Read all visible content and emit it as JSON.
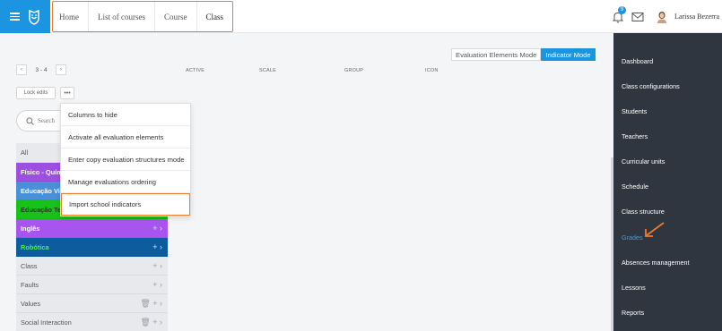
{
  "header": {
    "breadcrumbs": [
      "Home",
      "List of courses",
      "Course",
      "Class"
    ],
    "notifications_count": "9",
    "user_name": "Larissa Bezerra"
  },
  "modes": {
    "evaluation": "Evaluation Elements Mode",
    "indicator": "Indicator Mode"
  },
  "pager": {
    "prev": "‹",
    "range": "3 - 4",
    "next": "›"
  },
  "columns": [
    "ACTIVE",
    "SCALE",
    "GROUP",
    "ICON"
  ],
  "toolbar": {
    "lock_label": "Lock edits",
    "more_label": "•••"
  },
  "search": {
    "placeholder": "Search"
  },
  "list": {
    "all_label": "All",
    "items": [
      {
        "label": "Físico - Química",
        "bg": "#9c4fe0",
        "fg": "#ffffff"
      },
      {
        "label": "Educação Visual",
        "bg": "#4a90d9",
        "fg": "#ffffff"
      },
      {
        "label": "Educação Tecnológica",
        "bg": "#19c219",
        "fg": "#1a3a1a"
      },
      {
        "label": "Inglês",
        "bg": "#a855f0",
        "fg": "#ffffff",
        "actions": "+ ›"
      },
      {
        "label": "Robótica",
        "bg": "#0d5c9e",
        "fg": "#4cf04c",
        "actions": "+ ›"
      },
      {
        "label": "Class",
        "actions": "+ ›"
      },
      {
        "label": "Faults",
        "actions": "+ ›"
      },
      {
        "label": "Values",
        "actions": "🗑 + ›"
      },
      {
        "label": "Social Interaction",
        "actions": "🗑 + ›"
      }
    ]
  },
  "menu": {
    "items": [
      "Columns to hide",
      "Activate all evaluation elements",
      "Enter copy evaluation structures mode",
      "Manage evaluations ordering",
      "Import school indicators"
    ]
  },
  "sidebar": {
    "items": [
      "Dashboard",
      "Class configurations",
      "Students",
      "Teachers",
      "Curricular units",
      "Schedule",
      "Class structure",
      "Grades",
      "Absences management",
      "Lessons",
      "Reports"
    ],
    "active": "Grades"
  },
  "colors": {
    "accent": "#1b95e0",
    "highlight": "#f07b2a",
    "sidebar_bg": "#2f3640"
  }
}
